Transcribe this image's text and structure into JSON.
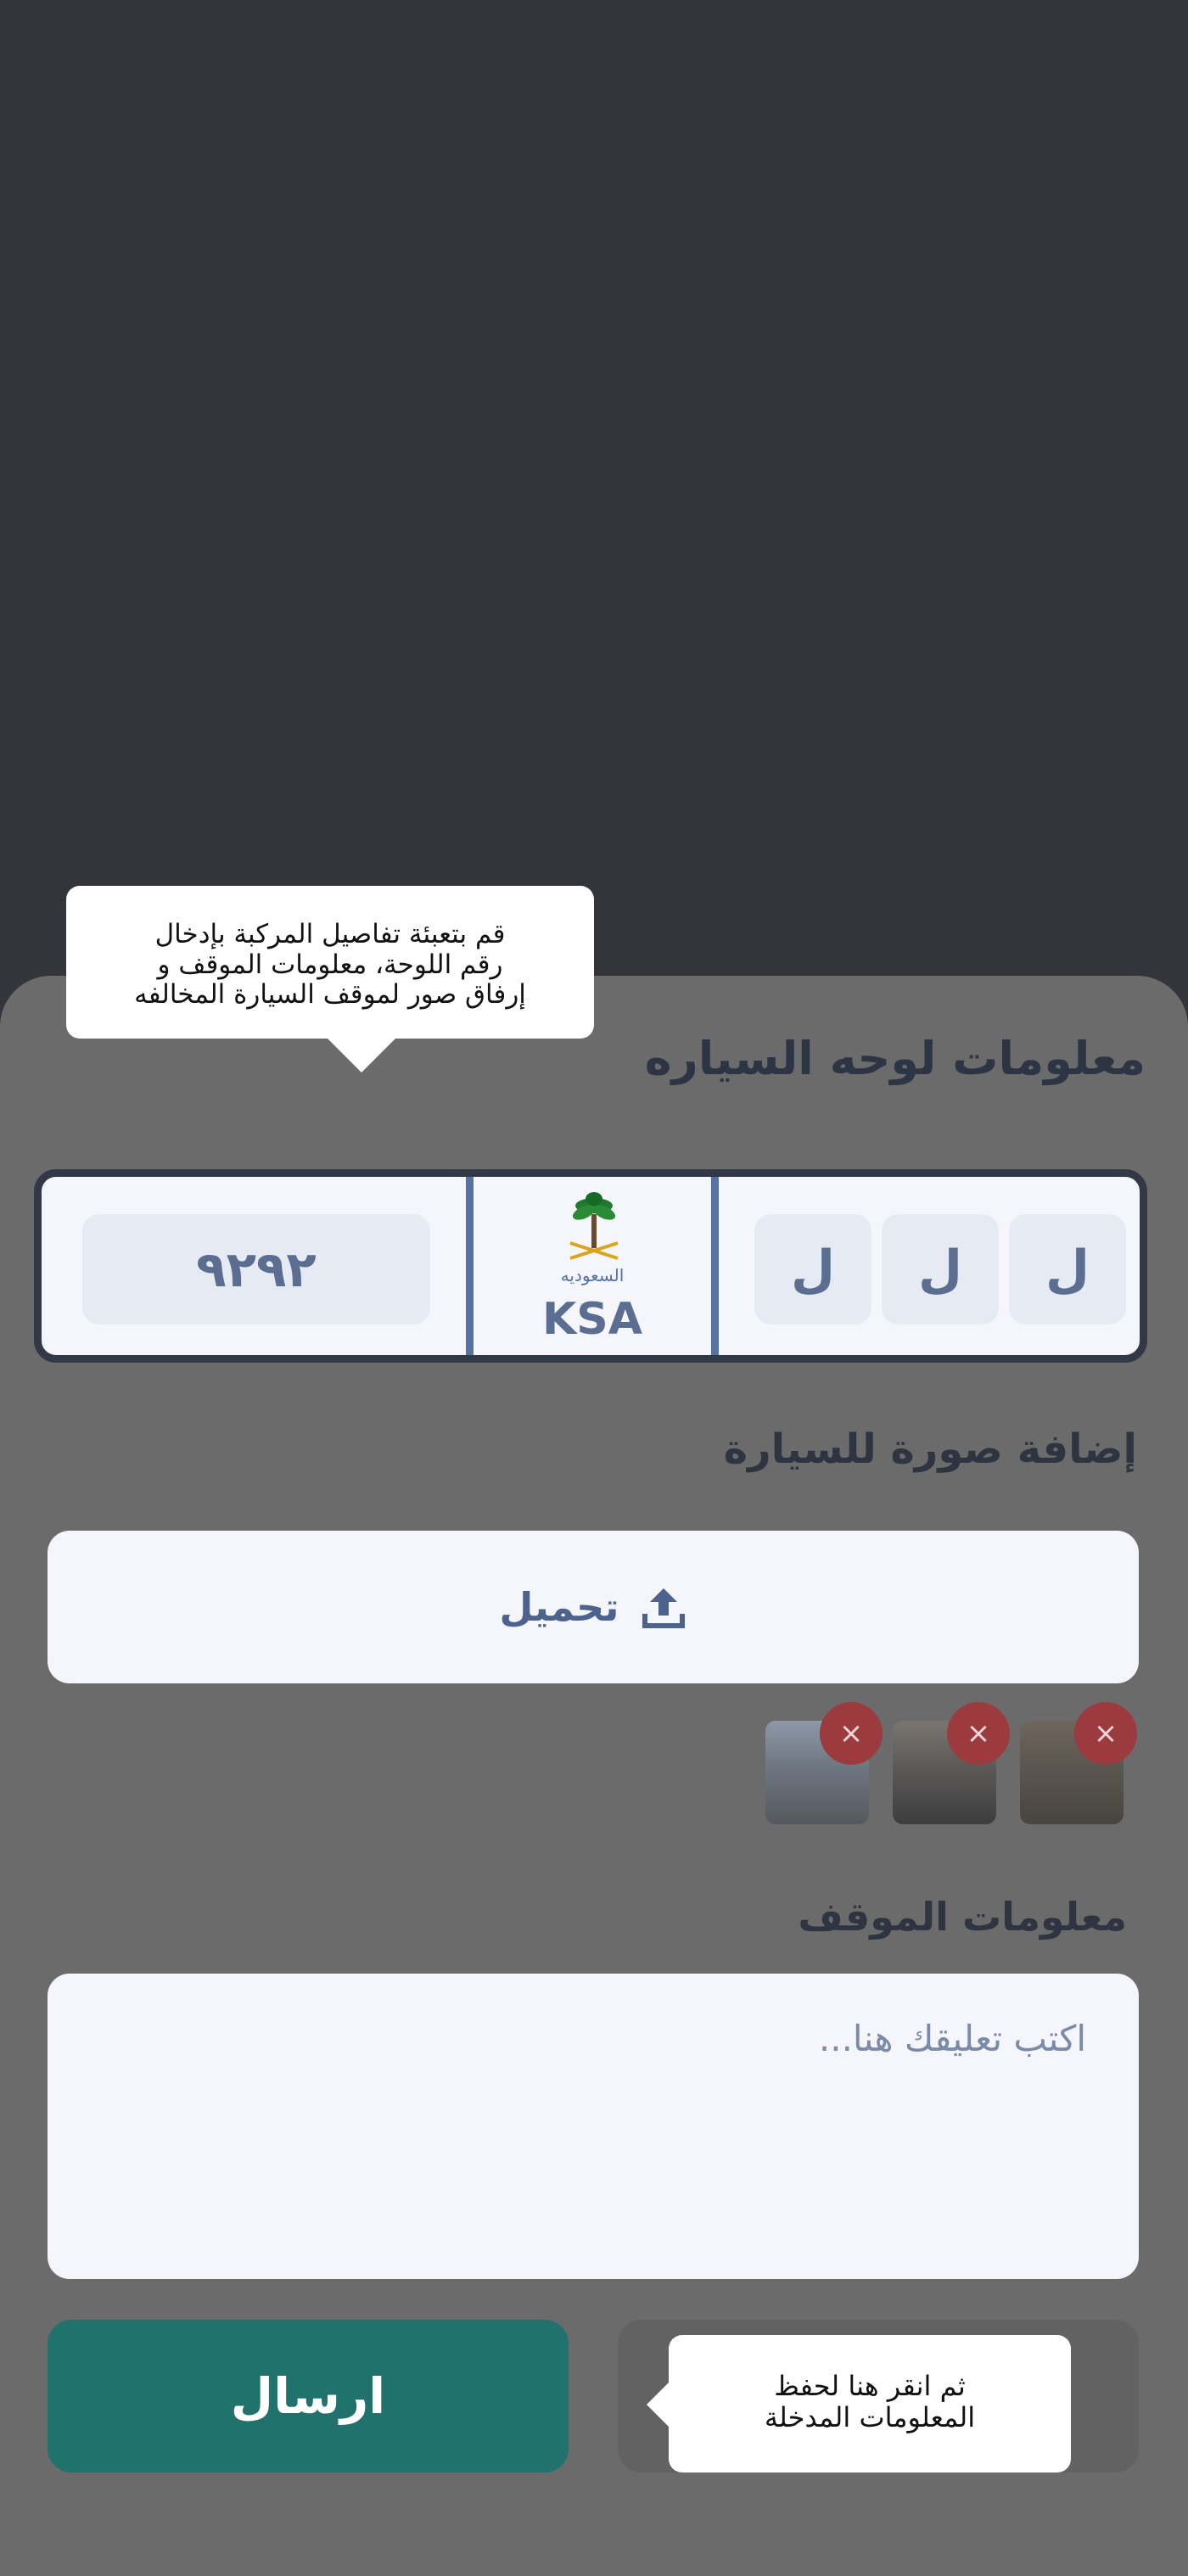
{
  "tooltips": {
    "intro_line1": "قم بتعبئة تفاصيل المركبة بإدخال",
    "intro_line2": "رقم اللوحة، معلومات الموقف و",
    "intro_line3": "إرفاق صور لموقف السيارة المخالفه",
    "save_line1": "ثم انقر هنا لحفظ",
    "save_line2": "المعلومات المدخلة"
  },
  "plate_section": {
    "title": "معلومات لوحه السياره",
    "number": "٩٢٩٢",
    "letters": [
      "ل",
      "ل",
      "ل"
    ],
    "country_arabic": "السعوديه",
    "country_code": "KSA"
  },
  "photo_section": {
    "title": "إضافة صورة للسيارة",
    "upload_label": "تحميل",
    "thumbnails": [
      "street-photo-1",
      "street-photo-2",
      "street-photo-3"
    ],
    "remove_symbol": "×"
  },
  "parking_section": {
    "title": "معلومات الموقف",
    "comment_placeholder": "اكتب تعليقك هنا..."
  },
  "actions": {
    "send_label": "ارسال"
  },
  "colors": {
    "page_bg": "#33353b",
    "sheet_bg": "#6b6b6b",
    "primary": "#21716c",
    "plate_text": "#5b6e92",
    "remove_btn": "#9b3b3f"
  }
}
